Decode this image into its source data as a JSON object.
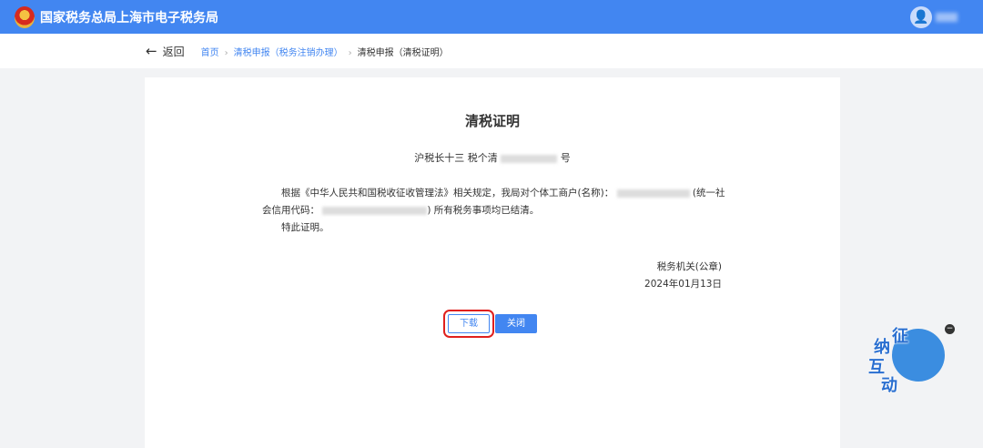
{
  "header": {
    "title": "国家税务总局上海市电子税务局"
  },
  "nav": {
    "back": "返回",
    "crumbs": [
      "首页",
      "清税申报（税务注销办理）"
    ],
    "current": "清税申报（清税证明）"
  },
  "certificate": {
    "title": "清税证明",
    "number_prefix": "沪税长十三 税个清",
    "number_suffix": "号",
    "para1_a": "根据《中华人民共和国税收征收管理法》相关规定，我局对个体工商户(名称)：",
    "para1_b": "(统一社会信用代码：",
    "para1_c": ") 所有税务事项均已结清。",
    "para2": "特此证明。",
    "authority": "税务机关(公章)",
    "date": "2024年01月13日"
  },
  "buttons": {
    "download": "下载",
    "close": "关闭"
  },
  "widget": {
    "chars": [
      "征",
      "纳",
      "互",
      "动"
    ],
    "minimize": "−"
  }
}
